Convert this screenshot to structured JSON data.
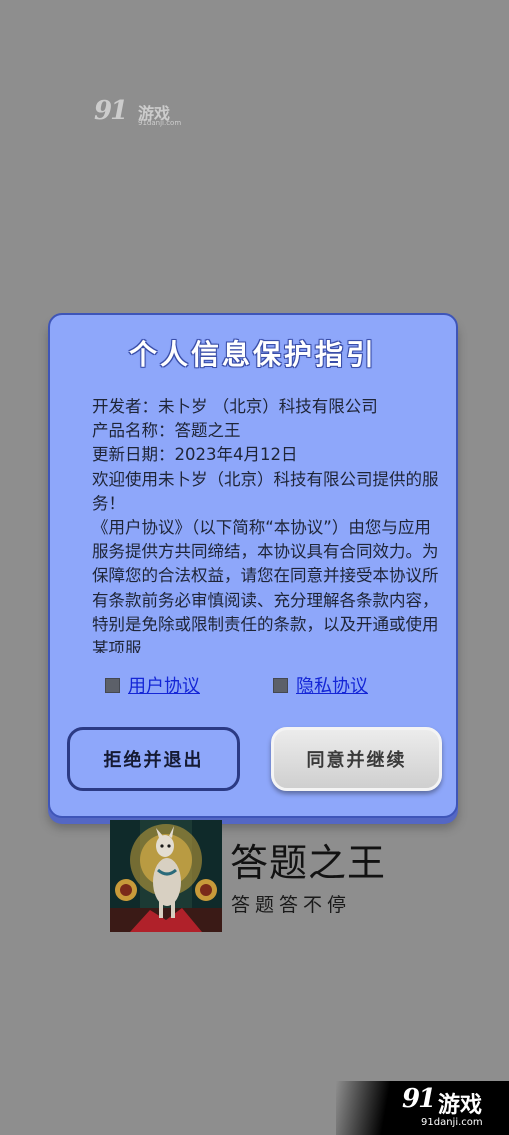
{
  "watermark_top": {
    "logo": "91",
    "text": "游戏",
    "url": "91danji.com"
  },
  "dialog": {
    "title": "个人信息保护指引",
    "body": [
      "开发者：未卜岁 （北京）科技有限公司",
      "产品名称：答题之王",
      "更新日期：2023年4月12日",
      "欢迎使用未卜岁（北京）科技有限公司提供的服务！",
      "《用户协议》（以下简称“本协议”）由您与应用服务提供方共同缔结，本协议具有合同效力。为保障您的合法权益，请您在同意并接受本协议所有条款前务必审慎阅读、充分理解各条款内容，特别是免除或限制责任的条款，以及开通或使用某项服"
    ],
    "links": {
      "user_agreement": "用户协议",
      "privacy_agreement": "隐私协议"
    },
    "buttons": {
      "reject": "拒绝并退出",
      "agree": "同意并继续"
    }
  },
  "app": {
    "name": "答题之王",
    "slogan": "答题答不停"
  },
  "watermark_bottom": {
    "logo": "91",
    "text": "游戏",
    "url": "91danji.com"
  },
  "colors": {
    "background": "#8e8e8e",
    "dialog_fill": "#8ea7fa",
    "dialog_border": "#3e55b8",
    "link": "#1426d6",
    "checkbox": "#5c6069"
  }
}
